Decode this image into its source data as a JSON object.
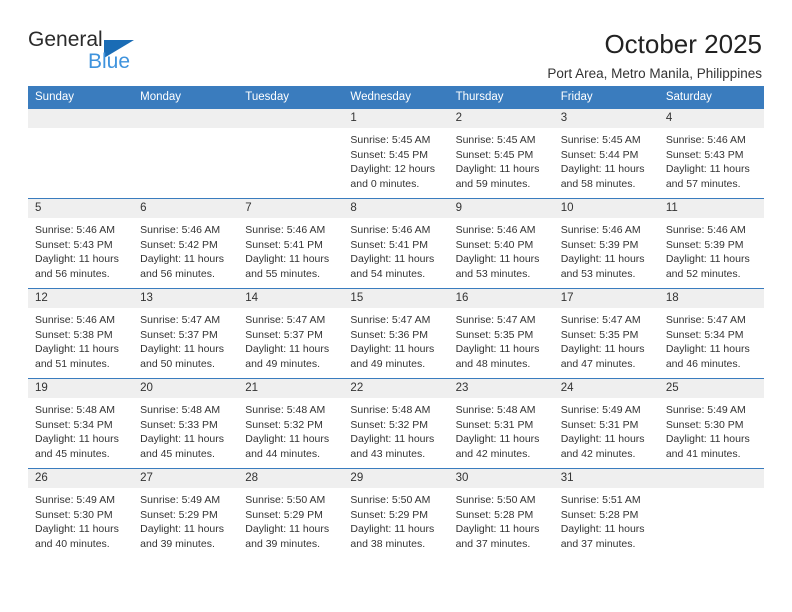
{
  "brand": {
    "name_top": "General",
    "name_bottom": "Blue",
    "flag_color": "#1a6cb5",
    "blue_color": "#3f93dd"
  },
  "header": {
    "title": "October 2025",
    "subtitle": "Port Area, Metro Manila, Philippines"
  },
  "theme": {
    "accent": "#3a7cbe",
    "daynum_bg": "#efefef",
    "text": "#333333"
  },
  "calendar": {
    "weekday_headers": [
      "Sunday",
      "Monday",
      "Tuesday",
      "Wednesday",
      "Thursday",
      "Friday",
      "Saturday"
    ],
    "weeks": [
      [
        {
          "day": "",
          "lines": []
        },
        {
          "day": "",
          "lines": []
        },
        {
          "day": "",
          "lines": []
        },
        {
          "day": "1",
          "lines": [
            "Sunrise: 5:45 AM",
            "Sunset: 5:45 PM",
            "Daylight: 12 hours",
            "and 0 minutes."
          ]
        },
        {
          "day": "2",
          "lines": [
            "Sunrise: 5:45 AM",
            "Sunset: 5:45 PM",
            "Daylight: 11 hours",
            "and 59 minutes."
          ]
        },
        {
          "day": "3",
          "lines": [
            "Sunrise: 5:45 AM",
            "Sunset: 5:44 PM",
            "Daylight: 11 hours",
            "and 58 minutes."
          ]
        },
        {
          "day": "4",
          "lines": [
            "Sunrise: 5:46 AM",
            "Sunset: 5:43 PM",
            "Daylight: 11 hours",
            "and 57 minutes."
          ]
        }
      ],
      [
        {
          "day": "5",
          "lines": [
            "Sunrise: 5:46 AM",
            "Sunset: 5:43 PM",
            "Daylight: 11 hours",
            "and 56 minutes."
          ]
        },
        {
          "day": "6",
          "lines": [
            "Sunrise: 5:46 AM",
            "Sunset: 5:42 PM",
            "Daylight: 11 hours",
            "and 56 minutes."
          ]
        },
        {
          "day": "7",
          "lines": [
            "Sunrise: 5:46 AM",
            "Sunset: 5:41 PM",
            "Daylight: 11 hours",
            "and 55 minutes."
          ]
        },
        {
          "day": "8",
          "lines": [
            "Sunrise: 5:46 AM",
            "Sunset: 5:41 PM",
            "Daylight: 11 hours",
            "and 54 minutes."
          ]
        },
        {
          "day": "9",
          "lines": [
            "Sunrise: 5:46 AM",
            "Sunset: 5:40 PM",
            "Daylight: 11 hours",
            "and 53 minutes."
          ]
        },
        {
          "day": "10",
          "lines": [
            "Sunrise: 5:46 AM",
            "Sunset: 5:39 PM",
            "Daylight: 11 hours",
            "and 53 minutes."
          ]
        },
        {
          "day": "11",
          "lines": [
            "Sunrise: 5:46 AM",
            "Sunset: 5:39 PM",
            "Daylight: 11 hours",
            "and 52 minutes."
          ]
        }
      ],
      [
        {
          "day": "12",
          "lines": [
            "Sunrise: 5:46 AM",
            "Sunset: 5:38 PM",
            "Daylight: 11 hours",
            "and 51 minutes."
          ]
        },
        {
          "day": "13",
          "lines": [
            "Sunrise: 5:47 AM",
            "Sunset: 5:37 PM",
            "Daylight: 11 hours",
            "and 50 minutes."
          ]
        },
        {
          "day": "14",
          "lines": [
            "Sunrise: 5:47 AM",
            "Sunset: 5:37 PM",
            "Daylight: 11 hours",
            "and 49 minutes."
          ]
        },
        {
          "day": "15",
          "lines": [
            "Sunrise: 5:47 AM",
            "Sunset: 5:36 PM",
            "Daylight: 11 hours",
            "and 49 minutes."
          ]
        },
        {
          "day": "16",
          "lines": [
            "Sunrise: 5:47 AM",
            "Sunset: 5:35 PM",
            "Daylight: 11 hours",
            "and 48 minutes."
          ]
        },
        {
          "day": "17",
          "lines": [
            "Sunrise: 5:47 AM",
            "Sunset: 5:35 PM",
            "Daylight: 11 hours",
            "and 47 minutes."
          ]
        },
        {
          "day": "18",
          "lines": [
            "Sunrise: 5:47 AM",
            "Sunset: 5:34 PM",
            "Daylight: 11 hours",
            "and 46 minutes."
          ]
        }
      ],
      [
        {
          "day": "19",
          "lines": [
            "Sunrise: 5:48 AM",
            "Sunset: 5:34 PM",
            "Daylight: 11 hours",
            "and 45 minutes."
          ]
        },
        {
          "day": "20",
          "lines": [
            "Sunrise: 5:48 AM",
            "Sunset: 5:33 PM",
            "Daylight: 11 hours",
            "and 45 minutes."
          ]
        },
        {
          "day": "21",
          "lines": [
            "Sunrise: 5:48 AM",
            "Sunset: 5:32 PM",
            "Daylight: 11 hours",
            "and 44 minutes."
          ]
        },
        {
          "day": "22",
          "lines": [
            "Sunrise: 5:48 AM",
            "Sunset: 5:32 PM",
            "Daylight: 11 hours",
            "and 43 minutes."
          ]
        },
        {
          "day": "23",
          "lines": [
            "Sunrise: 5:48 AM",
            "Sunset: 5:31 PM",
            "Daylight: 11 hours",
            "and 42 minutes."
          ]
        },
        {
          "day": "24",
          "lines": [
            "Sunrise: 5:49 AM",
            "Sunset: 5:31 PM",
            "Daylight: 11 hours",
            "and 42 minutes."
          ]
        },
        {
          "day": "25",
          "lines": [
            "Sunrise: 5:49 AM",
            "Sunset: 5:30 PM",
            "Daylight: 11 hours",
            "and 41 minutes."
          ]
        }
      ],
      [
        {
          "day": "26",
          "lines": [
            "Sunrise: 5:49 AM",
            "Sunset: 5:30 PM",
            "Daylight: 11 hours",
            "and 40 minutes."
          ]
        },
        {
          "day": "27",
          "lines": [
            "Sunrise: 5:49 AM",
            "Sunset: 5:29 PM",
            "Daylight: 11 hours",
            "and 39 minutes."
          ]
        },
        {
          "day": "28",
          "lines": [
            "Sunrise: 5:50 AM",
            "Sunset: 5:29 PM",
            "Daylight: 11 hours",
            "and 39 minutes."
          ]
        },
        {
          "day": "29",
          "lines": [
            "Sunrise: 5:50 AM",
            "Sunset: 5:29 PM",
            "Daylight: 11 hours",
            "and 38 minutes."
          ]
        },
        {
          "day": "30",
          "lines": [
            "Sunrise: 5:50 AM",
            "Sunset: 5:28 PM",
            "Daylight: 11 hours",
            "and 37 minutes."
          ]
        },
        {
          "day": "31",
          "lines": [
            "Sunrise: 5:51 AM",
            "Sunset: 5:28 PM",
            "Daylight: 11 hours",
            "and 37 minutes."
          ]
        },
        {
          "day": "",
          "lines": []
        }
      ]
    ]
  }
}
